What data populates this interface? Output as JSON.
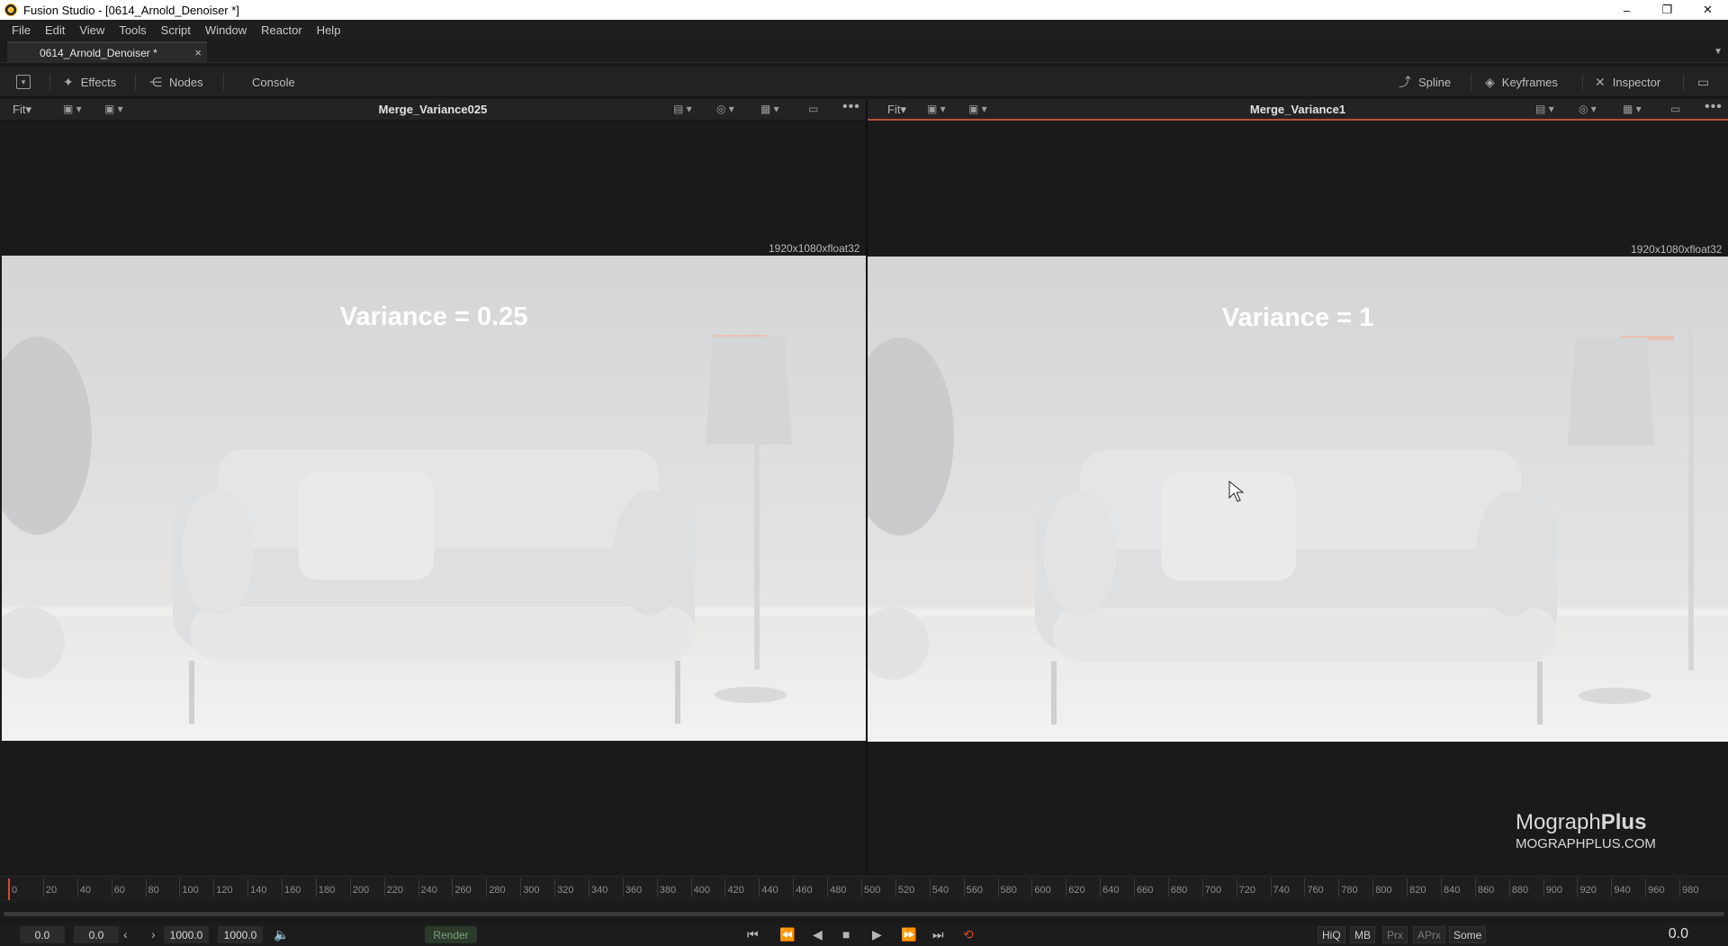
{
  "window": {
    "title": "Fusion Studio - [0614_Arnold_Denoiser *]",
    "minimize": "–",
    "restore": "❐",
    "close": "✕"
  },
  "menu": [
    "File",
    "Edit",
    "View",
    "Tools",
    "Script",
    "Window",
    "Reactor",
    "Help"
  ],
  "doc_tab": {
    "label": "0614_Arnold_Denoiser *",
    "close": "×"
  },
  "toolbar": {
    "effects": "Effects",
    "nodes": "Nodes",
    "console": "Console",
    "spline": "Spline",
    "keyframes": "Keyframes",
    "inspector": "Inspector"
  },
  "viewer_left": {
    "fit": "Fit",
    "node_name": "Merge_Variance025",
    "resolution": "1920x1080xfloat32",
    "overlay_text": "Variance = 0.25"
  },
  "viewer_right": {
    "fit": "Fit",
    "node_name": "Merge_Variance1",
    "resolution": "1920x1080xfloat32",
    "overlay_text": "Variance = 1"
  },
  "timeline": {
    "ticks": [
      "0",
      "20",
      "40",
      "60",
      "80",
      "100",
      "120",
      "140",
      "160",
      "180",
      "200",
      "220",
      "240",
      "260",
      "280",
      "300",
      "320",
      "340",
      "360",
      "380",
      "400",
      "420",
      "440",
      "460",
      "480",
      "500",
      "520",
      "540",
      "560",
      "580",
      "600",
      "620",
      "640",
      "660",
      "680",
      "700",
      "720",
      "740",
      "760",
      "780",
      "800",
      "820",
      "840",
      "860",
      "880",
      "900",
      "920",
      "940",
      "960",
      "980"
    ],
    "current_frame": 0
  },
  "transport": {
    "global_start": "0.0",
    "render_start": "0.0",
    "render_end": "1000.0",
    "global_end": "1000.0",
    "render_label": "Render",
    "hiq": "HiQ",
    "mb": "MB",
    "prx": "Prx",
    "aprx": "APrx",
    "some": "Some",
    "current_time": "0.0"
  },
  "watermark": {
    "brand_light": "Mograph",
    "brand_bold": "Plus",
    "url": "MOGRAPHPLUS.COM"
  },
  "colors": {
    "accent_orange": "#d24a2a",
    "render_green": "#7fa27a"
  }
}
